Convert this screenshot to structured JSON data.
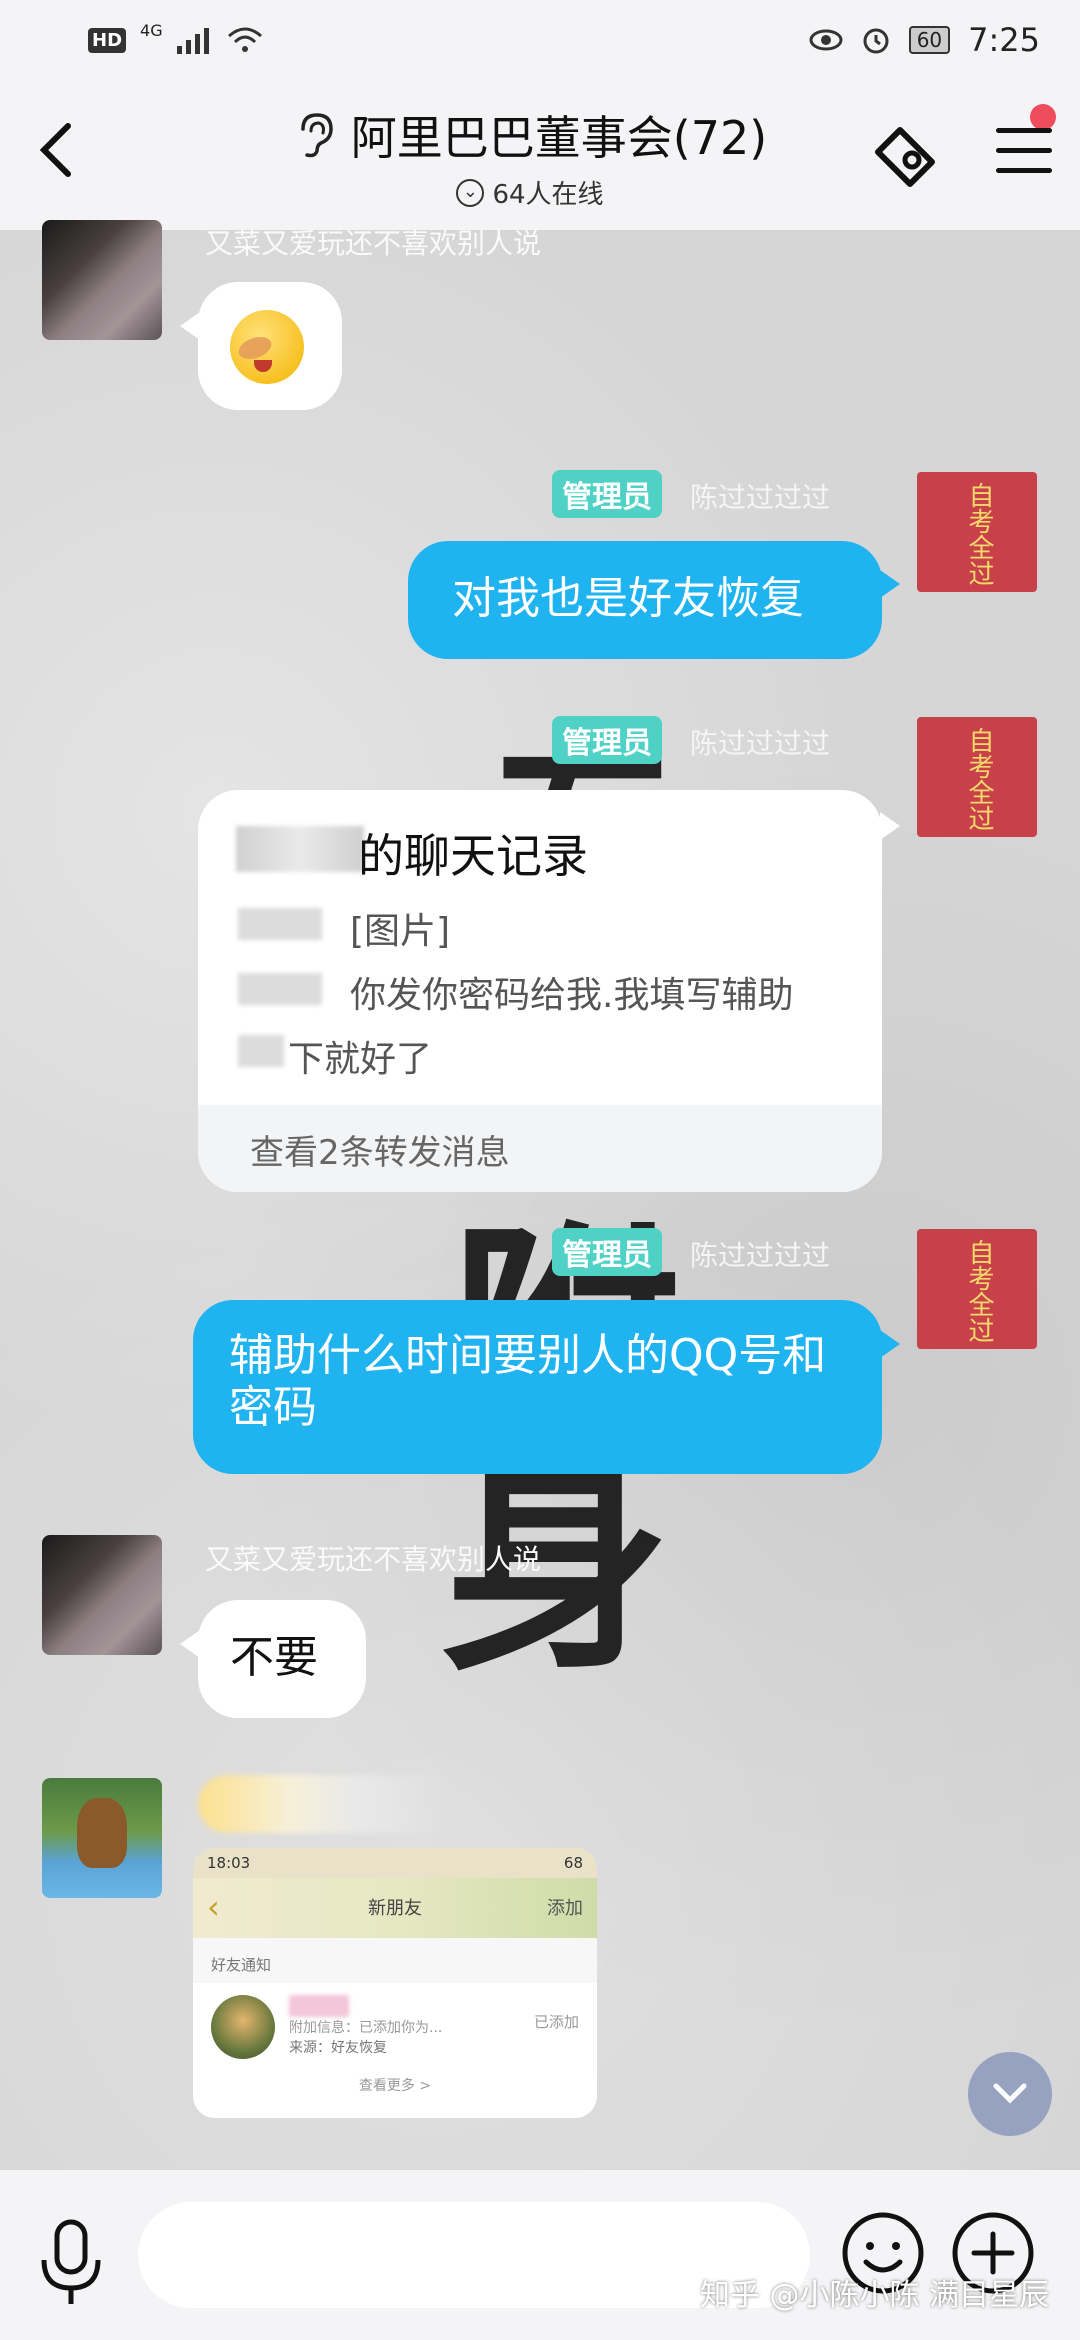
{
  "status_bar": {
    "hd": "HD",
    "network": "4G",
    "battery": "60",
    "time": "7:25"
  },
  "header": {
    "title": "阿里巴巴董事会(72)",
    "online": "64人在线",
    "back_icon": "back-arrow-icon",
    "mode_icon": "ear-icon",
    "tag_icon": "tag-icon",
    "menu_icon": "menu-icon"
  },
  "messages": [
    {
      "sender": "又菜又爱玩还不喜欢别人说",
      "type": "emoji",
      "emoji": "laugh-cry-emoji"
    },
    {
      "badge": "管理员",
      "sender": "陈过过过过",
      "avatar_text": "自考全过",
      "text": "对我也是好友恢复"
    },
    {
      "badge": "管理员",
      "sender": "陈过过过过",
      "avatar_text": "自考全过",
      "record": {
        "title": "的聊天记录",
        "line1": "[图片]",
        "line2": "你发你密码给我.我填写辅助",
        "line3": "下就好了",
        "footer": "查看2条转发消息"
      }
    },
    {
      "badge": "管理员",
      "sender": "陈过过过过",
      "avatar_text": "自考全过",
      "text": "辅助什么时间要别人的QQ号和密码"
    },
    {
      "sender": "又菜又爱玩还不喜欢别人说",
      "text": "不要"
    },
    {
      "type": "image",
      "screenshot": {
        "time": "18:03",
        "battery": "68",
        "title": "新朋友",
        "action": "添加",
        "section": "好友通知",
        "info": "附加信息：已添加你为...",
        "source": "来源：好友恢复",
        "status": "已添加",
        "more": "查看更多 >"
      }
    }
  ],
  "background_chars": [
    "专",
    "附",
    "身"
  ],
  "input": {
    "placeholder": "",
    "value": ""
  },
  "watermark": "知乎 @小陈小陈 满目星辰",
  "colors": {
    "blue_bubble": "#1fb3f0",
    "admin_badge": "#4fd1c5",
    "red_avatar": "#c8414a"
  }
}
